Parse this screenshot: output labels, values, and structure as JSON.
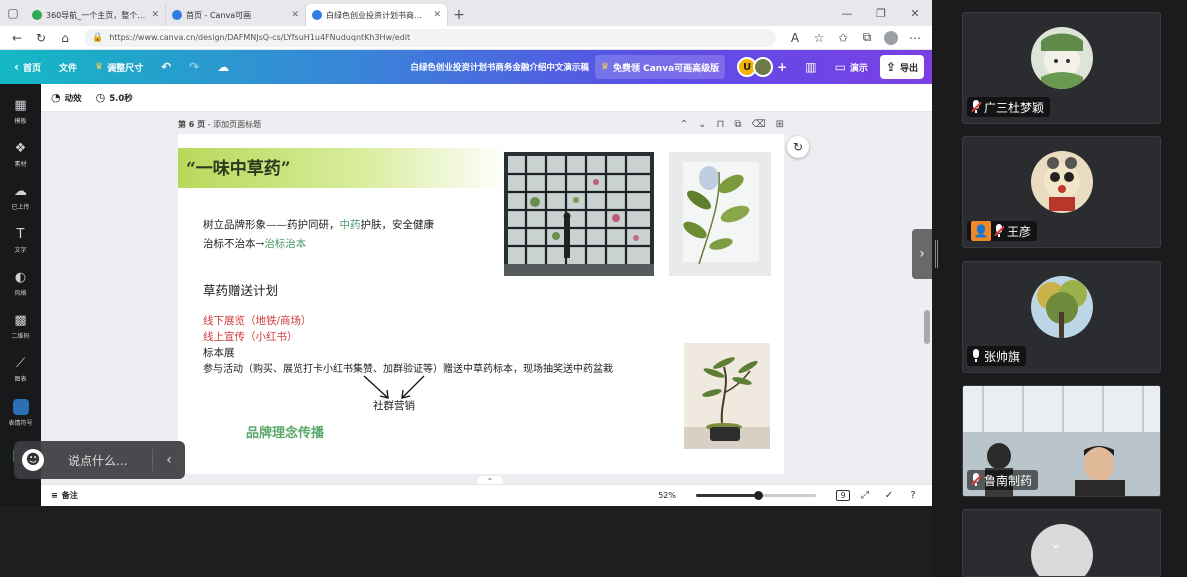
{
  "browser": {
    "tabs": [
      {
        "title": "360导航_一个主页，整个世界",
        "color": "#2fa84f"
      },
      {
        "title": "首页 - Canva可画",
        "color": "#2f7de1"
      },
      {
        "title": "白绿色创业投资计划书商务金融介绍中文演示",
        "color": "#2f7de1",
        "active": true
      }
    ],
    "new_tab": "+",
    "url": "https://www.canva.cn/design/DAFMNJsQ-cs/LYfsuH1u4FNuduqntKh3Hw/edit"
  },
  "canva": {
    "home": "首页",
    "file": "文件",
    "resize": "调整尺寸",
    "doc_title": "白绿色创业投资计划书商务金融介绍中文演示稿",
    "pro_offer": "免费领 Canva可画高级版",
    "avatar_letter": "U",
    "present": "演示",
    "export": "导出"
  },
  "sidebar": {
    "items": [
      {
        "label": "模板",
        "icon": "▦"
      },
      {
        "label": "素材",
        "icon": "❖"
      },
      {
        "label": "已上传",
        "icon": "☁"
      },
      {
        "label": "文字",
        "icon": "T"
      },
      {
        "label": "风格",
        "icon": "◐"
      },
      {
        "label": "二维码",
        "icon": "▩"
      },
      {
        "label": "图表",
        "icon": "⟋"
      },
      {
        "label": "表情符号"
      }
    ]
  },
  "props": {
    "animate": "动效",
    "duration": "5.0秒"
  },
  "page": {
    "number": "第 6 页",
    "add_title": "添加页面标题"
  },
  "slide": {
    "title": "“一味中草药”",
    "line1_a": "树立品牌形象——药护同研，",
    "line1_b": "中药",
    "line1_c": "护肤，安全健康",
    "line2_a": "治标不治本→",
    "line2_b": "治标治本",
    "plan_title": "草药赠送计划",
    "offline": "线下展览（地铁/商场）",
    "online": "线上宣传（小红书）",
    "specimen": "标本展",
    "activity": "参与活动（购买、展览打卡小红书集赞、加群验证等）赠送中草药标本，现场抽奖送中药盆栽",
    "community": "社群营销",
    "brand": "品牌理念传播"
  },
  "bottom": {
    "notes": "备注",
    "zoom": "52%",
    "zoom_fraction": 0.52,
    "page_count": "9"
  },
  "chat": {
    "placeholder": "说点什么..."
  },
  "participants": [
    {
      "name": "广三杜梦颖",
      "muted": true
    },
    {
      "name": "王彦",
      "muted": true,
      "has_user_icon": true
    },
    {
      "name": "张帅旗",
      "muted": false
    },
    {
      "name": "鲁南制药",
      "muted": true
    }
  ]
}
